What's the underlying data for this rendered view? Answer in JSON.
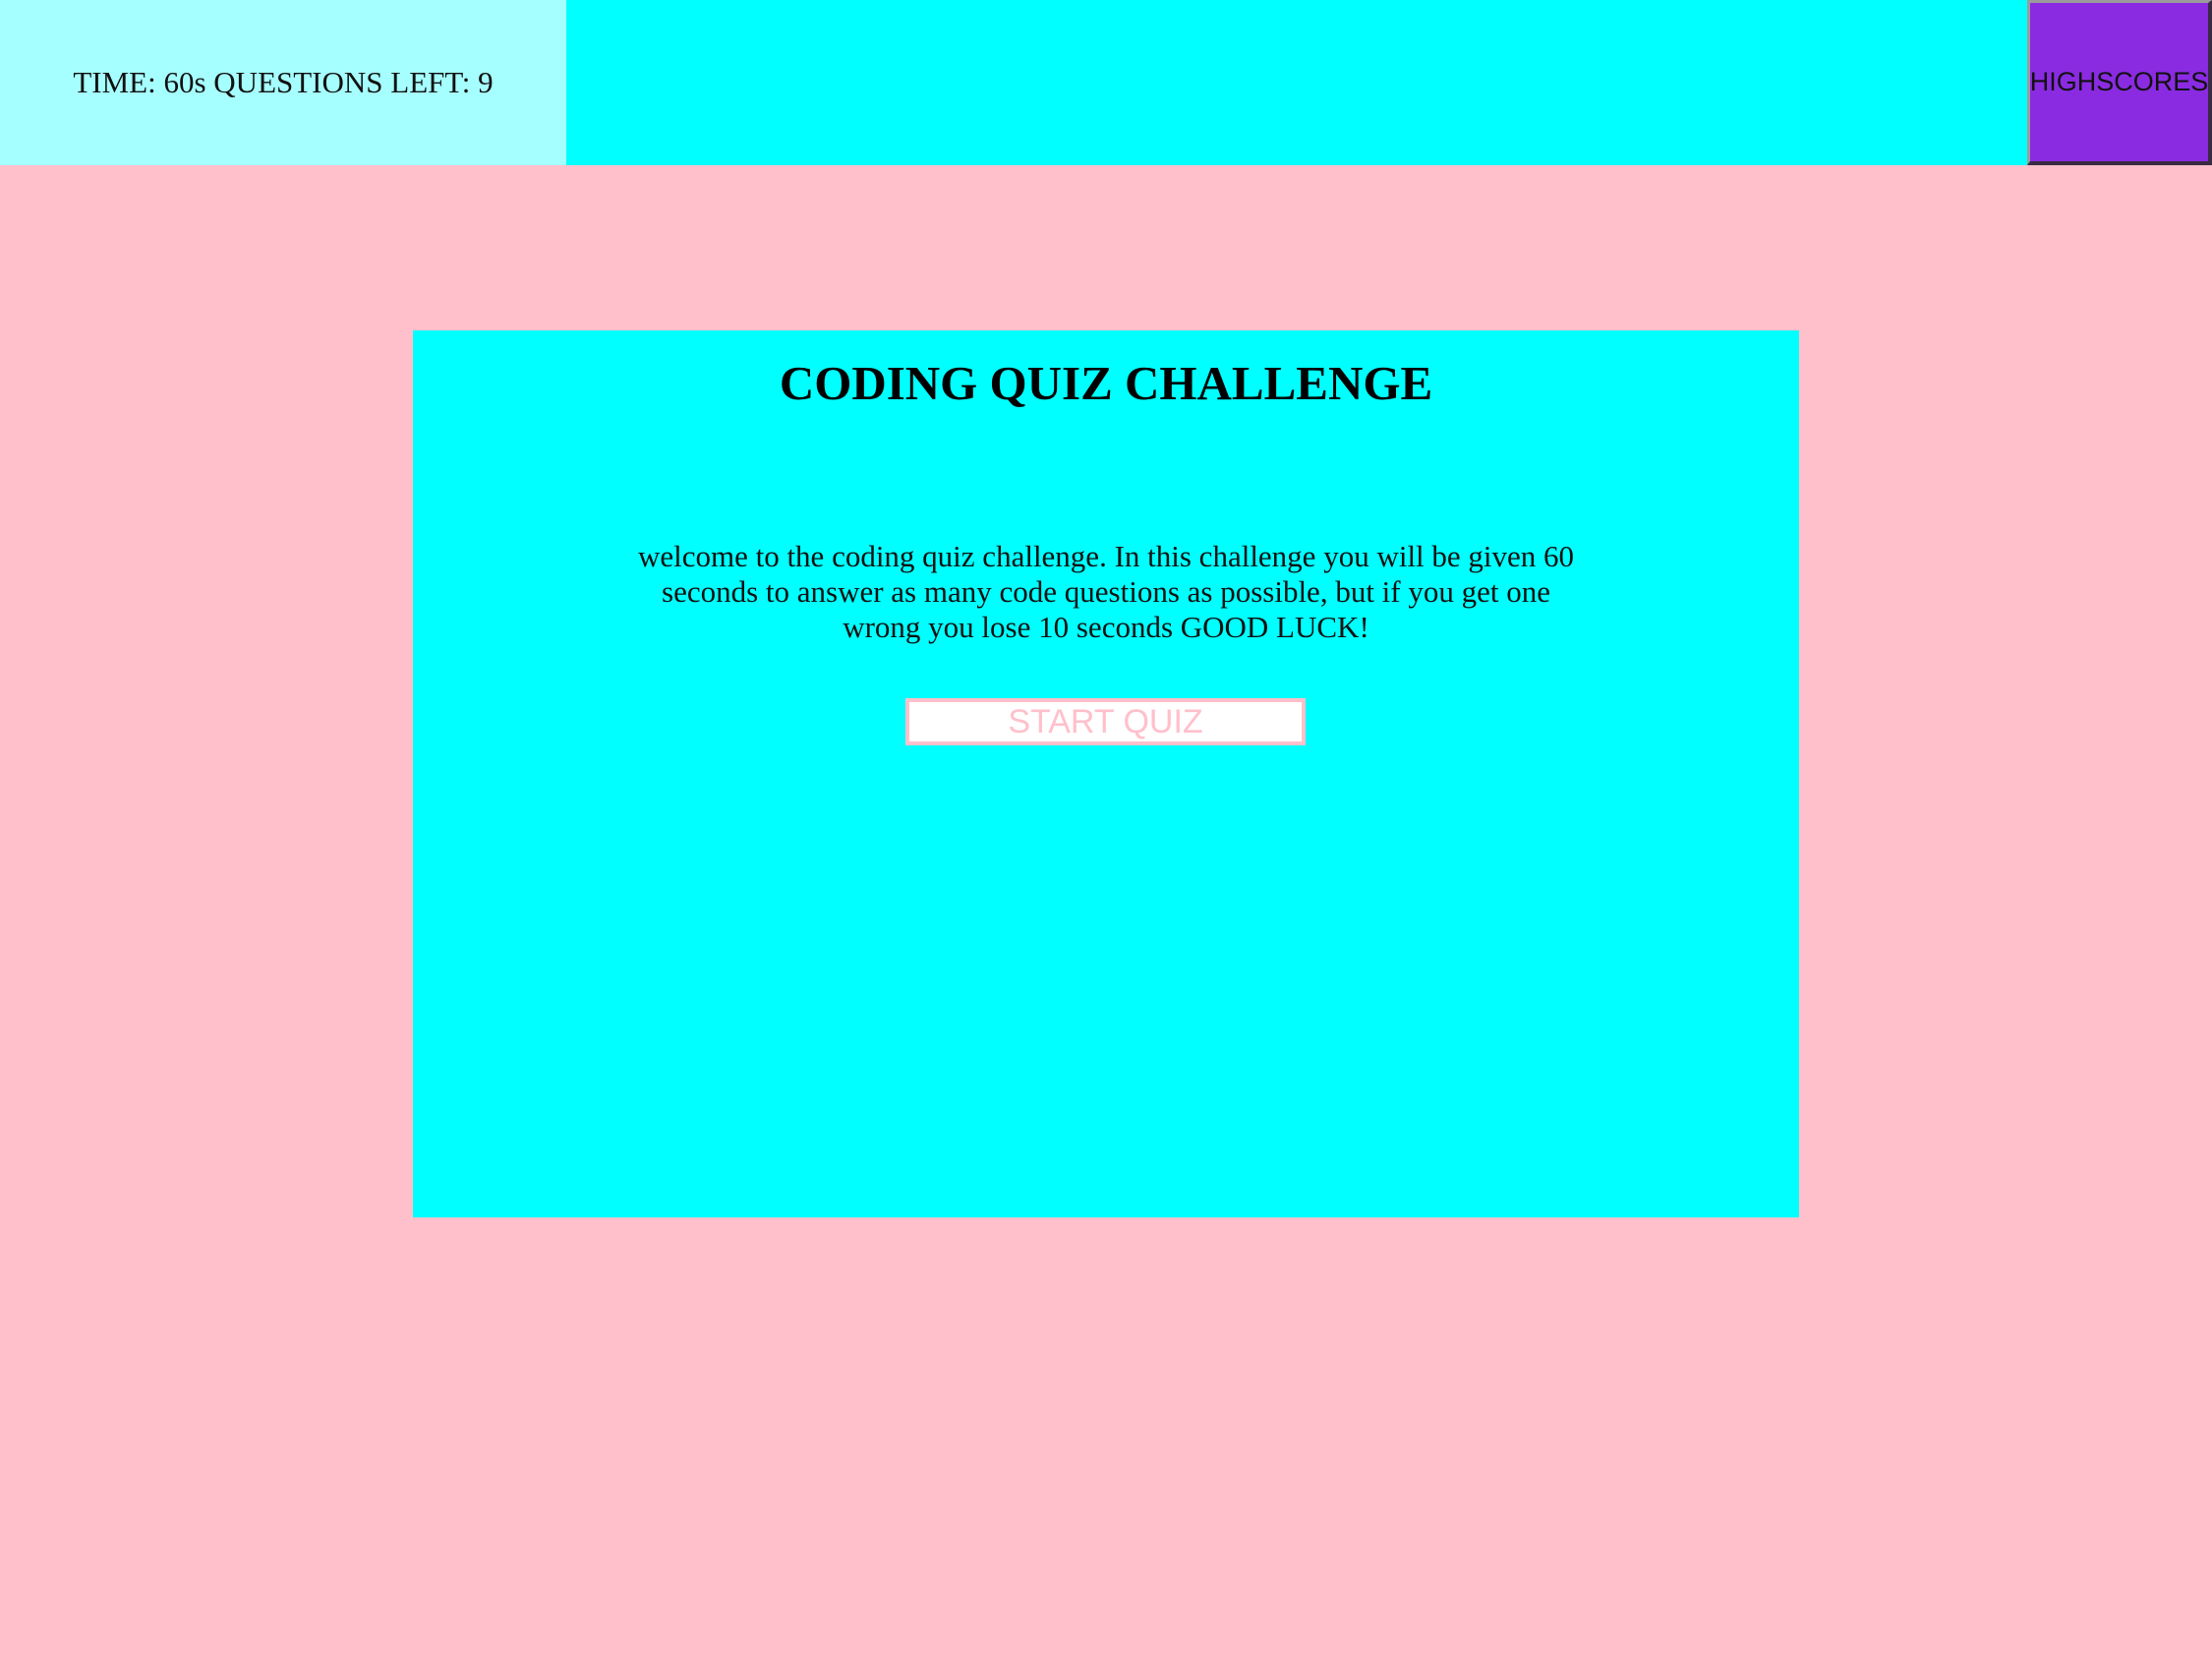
{
  "header": {
    "status_text": "TIME: 60s QUESTIONS LEFT: 9",
    "highscores_label": "HIGHSCORES"
  },
  "quiz": {
    "title": "CODING QUIZ CHALLENGE",
    "description": "welcome to the coding quiz challenge. In this challenge you will be given 60 seconds to answer as many code questions as possible, but if you get one wrong you lose 10 seconds GOOD LUCK!",
    "start_label": "START QUIZ"
  },
  "colors": {
    "page_background": "#ffc0cb",
    "header_background": "#00ffff",
    "timer_background": "#a6ffff",
    "highscores_background": "#8a2be2",
    "card_background": "#00ffff",
    "start_button_text": "#ffc0cb"
  }
}
